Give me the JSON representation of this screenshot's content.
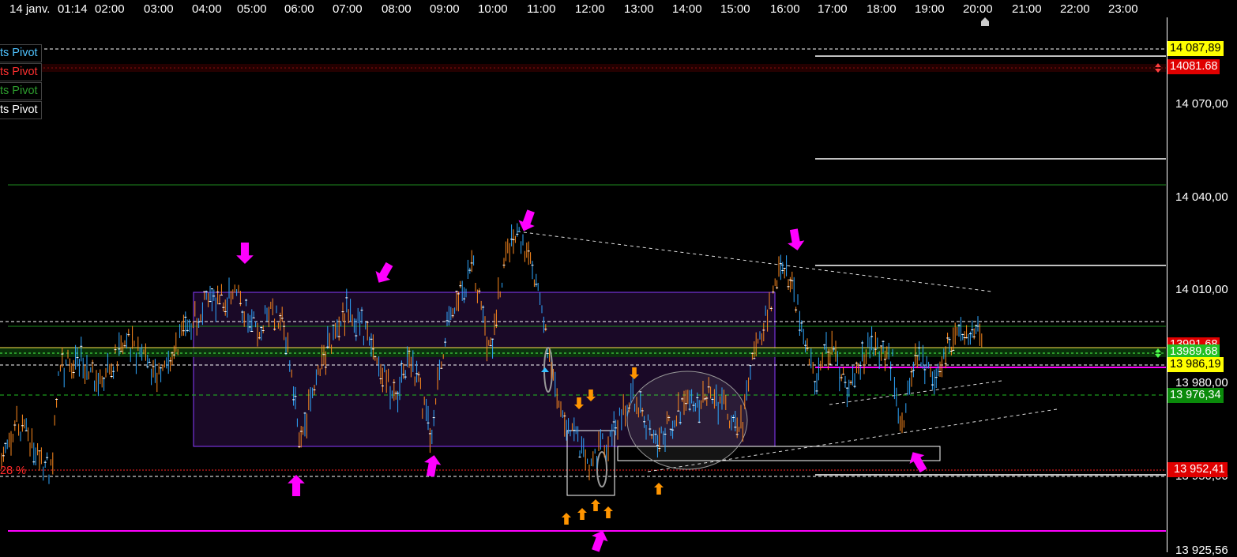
{
  "time_axis": {
    "labels": [
      "14 janv.",
      "01:14",
      "02:00",
      "03:00",
      "04:00",
      "05:00",
      "06:00",
      "07:00",
      "08:00",
      "09:00",
      "10:00",
      "11:00",
      "12:00",
      "13:00",
      "14:00",
      "15:00",
      "16:00",
      "17:00",
      "18:00",
      "19:00",
      "20:00",
      "21:00",
      "22:00",
      "23:00"
    ]
  },
  "price_axis": {
    "labels": [
      "14 070,00",
      "14 040,00",
      "14 010,00",
      "13 980,00",
      "13 950,00",
      "13 925,56"
    ]
  },
  "price_tags": {
    "top_yellow": "14 087,89",
    "red_pivot": "14081.68",
    "green_current": "13989.68",
    "red_partial": "13991.68",
    "yellow_low": "13 986,19",
    "green_lower": "13 976,34",
    "red_bottom": "13 952,41"
  },
  "pivot_labels": [
    {
      "text": "ts Pivot",
      "color": "#4fc3ff"
    },
    {
      "text": "ts Pivot",
      "color": "#ff3030"
    },
    {
      "text": "ts Pivot",
      "color": "#2e9e2e"
    },
    {
      "text": "ts Pivot",
      "color": "#ffffff"
    }
  ],
  "percent_label": "28 %",
  "colors": {
    "magenta": "#ff00ff",
    "orange_arrow": "#ff9500",
    "range_box": "#8a3cff",
    "candle_up": "#2fa8ff",
    "candle_down": "#ff8a1e"
  }
}
